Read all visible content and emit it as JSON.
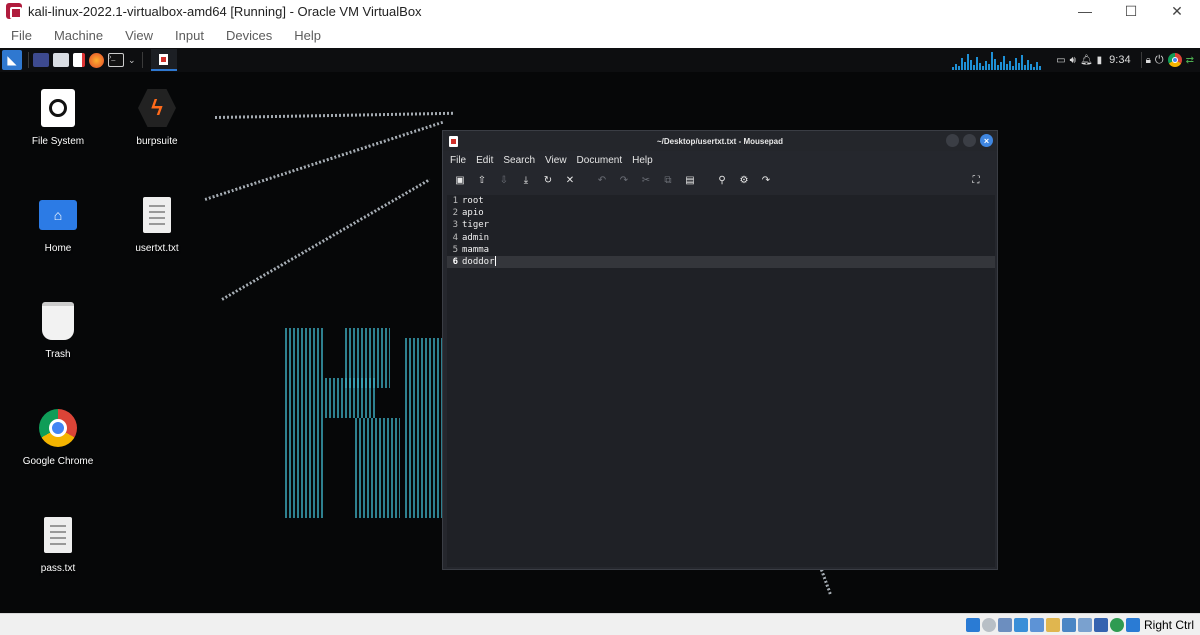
{
  "host": {
    "title": "kali-linux-2022.1-virtualbox-amd64 [Running] - Oracle VM VirtualBox",
    "controls": {
      "minimize": "—",
      "maximize": "☐",
      "close": "✕"
    },
    "menu": [
      "File",
      "Machine",
      "View",
      "Input",
      "Devices",
      "Help"
    ],
    "host_key": "Right Ctrl"
  },
  "panel": {
    "clock": "9:34",
    "icons": [
      "kali-menu-icon",
      "workspace-icon",
      "file-manager-icon",
      "text-editor-icon",
      "firefox-icon",
      "terminal-icon",
      "mousepad-task-icon",
      "cpu-graph",
      "display-icon",
      "volume-icon",
      "notification-icon",
      "battery-icon",
      "lock-icon",
      "power-icon",
      "chrome-icon",
      "network-icon"
    ]
  },
  "desktop": {
    "icons": [
      {
        "label": "File System",
        "icon": "drive-icon"
      },
      {
        "label": "burpsuite",
        "icon": "burpsuite-icon"
      },
      {
        "label": "Home",
        "icon": "home-folder-icon"
      },
      {
        "label": "usertxt.txt",
        "icon": "text-file-icon"
      },
      {
        "label": "Trash",
        "icon": "trash-icon"
      },
      {
        "label": "Google Chrome",
        "icon": "chrome-icon"
      },
      {
        "label": "pass.txt",
        "icon": "text-file-icon"
      }
    ]
  },
  "mousepad": {
    "title": "~/Desktop/usertxt.txt - Mousepad",
    "menu": [
      "File",
      "Edit",
      "Search",
      "View",
      "Document",
      "Help"
    ],
    "lines": [
      {
        "n": "1",
        "text": "root"
      },
      {
        "n": "2",
        "text": "apio"
      },
      {
        "n": "3",
        "text": "tiger"
      },
      {
        "n": "4",
        "text": "admin"
      },
      {
        "n": "5",
        "text": "mamma"
      },
      {
        "n": "6",
        "text": "doddor"
      }
    ],
    "current_line": 6
  },
  "colors": {
    "accent": "#2f78d0",
    "desktop_bg": "#060708",
    "editor_bg": "#1f2126",
    "window_bg": "#25272d"
  }
}
